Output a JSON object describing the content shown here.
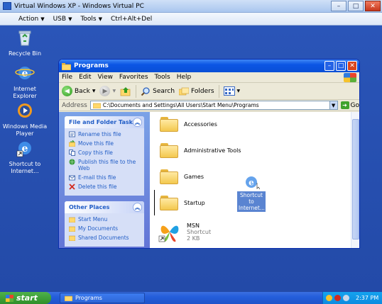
{
  "host": {
    "title": "Virtual Windows XP - Windows Virtual PC",
    "menu": [
      {
        "label": "Action",
        "caret": "▼"
      },
      {
        "label": "USB",
        "caret": "▼"
      },
      {
        "label": "Tools",
        "caret": "▼"
      },
      {
        "label": "Ctrl+Alt+Del",
        "caret": ""
      }
    ],
    "controls": {
      "minimize": "–",
      "maximize": "□",
      "close": "✕"
    }
  },
  "desktop_icons": [
    {
      "label": "Recycle Bin",
      "icon": "recycle-bin-icon"
    },
    {
      "label": "Internet Explorer",
      "icon": "internet-explorer-icon"
    },
    {
      "label": "Windows Media Player",
      "icon": "windows-media-player-icon"
    },
    {
      "label": "Shortcut to Internet...",
      "icon": "ie-shortcut-icon"
    }
  ],
  "explorer": {
    "title": "Programs",
    "menu": [
      "File",
      "Edit",
      "View",
      "Favorites",
      "Tools",
      "Help"
    ],
    "toolbar": {
      "back": "Back",
      "search": "Search",
      "folders": "Folders"
    },
    "address": {
      "label": "Address",
      "path": "C:\\Documents and Settings\\All Users\\Start Menu\\Programs",
      "go": "Go"
    },
    "tasks": {
      "title": "File and Folder Tasks",
      "items": [
        {
          "label": "Rename this file",
          "icon": "rename-icon"
        },
        {
          "label": "Move this file",
          "icon": "move-icon"
        },
        {
          "label": "Copy this file",
          "icon": "copy-icon"
        },
        {
          "label": "Publish this file to the Web",
          "icon": "publish-icon"
        },
        {
          "label": "E-mail this file",
          "icon": "email-icon"
        },
        {
          "label": "Delete this file",
          "icon": "delete-icon"
        }
      ]
    },
    "places": {
      "title": "Other Places",
      "items": [
        {
          "label": "Start Menu"
        },
        {
          "label": "My Documents"
        },
        {
          "label": "Shared Documents"
        }
      ]
    },
    "files": [
      {
        "name": "Accessories",
        "type": "folder"
      },
      {
        "name": "Administrative Tools",
        "type": "folder"
      },
      {
        "name": "Games",
        "type": "folder"
      },
      {
        "name": "Startup",
        "type": "folder"
      },
      {
        "name": "MSN",
        "type": "shortcut",
        "kind": "Shortcut",
        "size": "2 KB"
      }
    ],
    "drag_item": "Shortcut to Internet..."
  },
  "taskbar": {
    "start": "start",
    "task": "Programs",
    "clock": "2:37 PM"
  },
  "colors": {
    "desktop": "#234aa8",
    "titlebar": "#0b55e4",
    "taskpane": "#6f8fe0"
  }
}
